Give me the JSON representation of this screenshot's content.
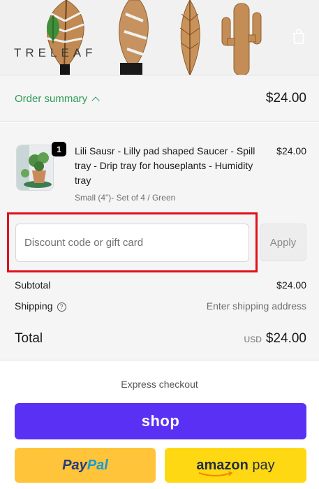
{
  "header": {
    "logo_text": "TRELEAF",
    "bag_icon": "shopping-bag-icon"
  },
  "summary": {
    "toggle_label": "Order summary",
    "toggle_icon": "chevron-up-icon",
    "total": "$24.00"
  },
  "product": {
    "quantity": "1",
    "title": "Lili Sausr - Lilly pad shaped Saucer - Spill tray - Drip tray for houseplants - Humidity tray",
    "variant": "Small (4\")- Set of 4 / Green",
    "price": "$24.00"
  },
  "discount": {
    "placeholder": "Discount code or gift card",
    "value": "",
    "apply_label": "Apply"
  },
  "totals": {
    "subtotal_label": "Subtotal",
    "subtotal_value": "$24.00",
    "shipping_label": "Shipping",
    "shipping_help_icon": "question-circle-icon",
    "shipping_value": "Enter shipping address",
    "total_label": "Total",
    "currency": "USD",
    "total_value": "$24.00"
  },
  "express": {
    "title": "Express checkout",
    "shop_label": "shop",
    "paypal_part1": "Pay",
    "paypal_part2": "Pal",
    "amazon_label_1": "amazon",
    "amazon_label_2": "pay"
  },
  "colors": {
    "accent_green": "#2f9a56",
    "shop_purple": "#5a31f4",
    "paypal_yellow": "#ffc439",
    "amazon_yellow": "#ffd814",
    "highlight_red": "#e0101a"
  }
}
